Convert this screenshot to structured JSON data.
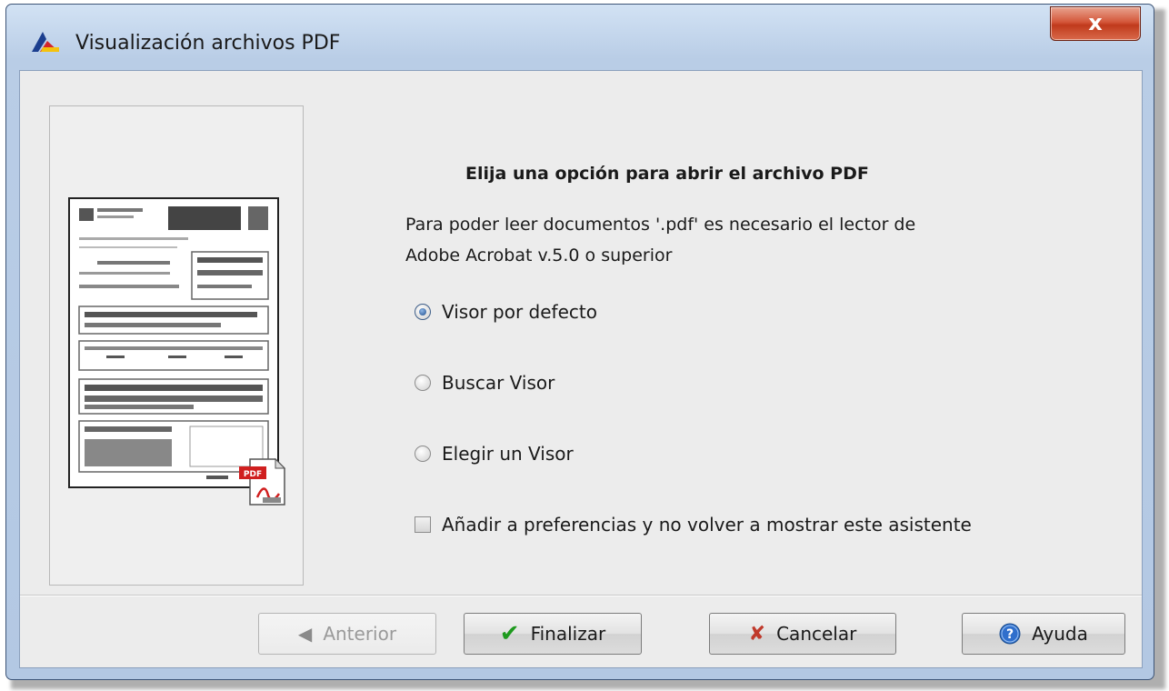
{
  "window": {
    "title": "Visualización archivos PDF",
    "close_label": "x"
  },
  "content": {
    "heading": "Elija una opción para abrir el archivo PDF",
    "description_line1": "Para poder leer documentos '.pdf' es necesario el lector de",
    "description_line2": "Adobe Acrobat v.5.0 o superior",
    "options": [
      {
        "label": "Visor por defecto",
        "selected": true
      },
      {
        "label": "Buscar Visor",
        "selected": false
      },
      {
        "label": "Elegir un Visor",
        "selected": false
      }
    ],
    "checkbox_label": "Añadir a preferencias y no volver a mostrar este asistente",
    "checkbox_checked": false
  },
  "buttons": {
    "prev": "Anterior",
    "finish": "Finalizar",
    "cancel": "Cancelar",
    "help": "Ayuda"
  },
  "icons": {
    "app": "app-logo-icon",
    "prev": "arrow-left-icon",
    "finish": "checkmark-icon",
    "cancel": "x-icon",
    "help": "help-icon",
    "pdf": "pdf-file-icon"
  },
  "colors": {
    "accent": "#1c4d8c",
    "close": "#c03a1c",
    "check": "#1e9a1e",
    "cancel": "#c0392b"
  }
}
